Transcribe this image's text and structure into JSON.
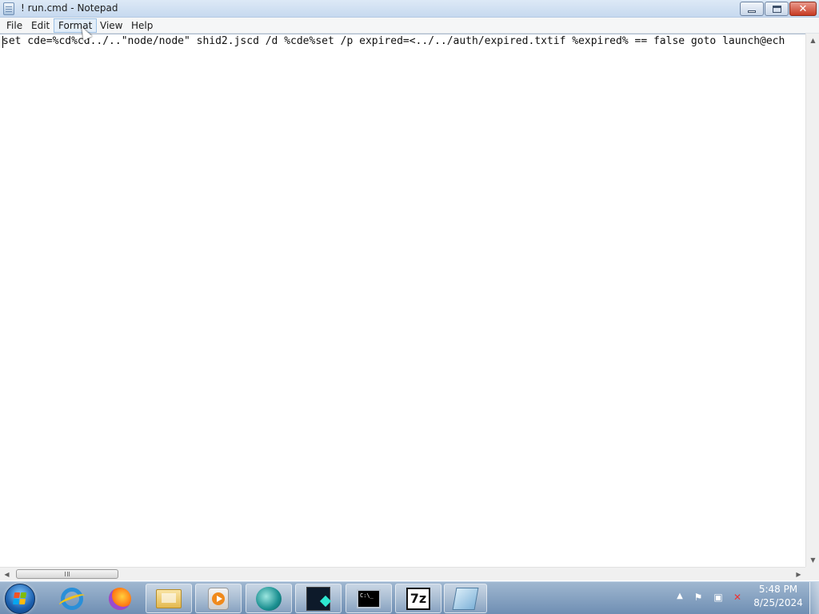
{
  "window": {
    "title": "! run.cmd - Notepad",
    "close_glyph": "✕"
  },
  "menu": {
    "file": "File",
    "edit": "Edit",
    "format": "Format",
    "view": "View",
    "help": "Help"
  },
  "editor": {
    "content": "set cde=%cd%cd../..\"node/node\" shid2.jscd /d %cde%set /p expired=<../../auth/expired.txtif %expired% == false goto launch@ech"
  },
  "scrollbars": {
    "up_arrow": "▲",
    "down_arrow": "▼",
    "left_arrow": "◀",
    "right_arrow": "▶"
  },
  "taskbar": {
    "apps": [
      "Internet Explorer",
      "Firefox",
      "Windows Explorer",
      "Windows Media Player",
      "App",
      "App",
      "Command Prompt",
      "7-Zip",
      "Notepad"
    ],
    "seven_zip_label": "7z",
    "tray_chevron": "▲",
    "tray_flag": "⚑",
    "tray_network": "▣",
    "tray_volume": "✕",
    "time": "5:48 PM",
    "date": "8/25/2024"
  },
  "colors": {
    "titlebar": "#c6d9ef",
    "taskbar": "#7f9bbd",
    "close_button": "#c73a23"
  }
}
